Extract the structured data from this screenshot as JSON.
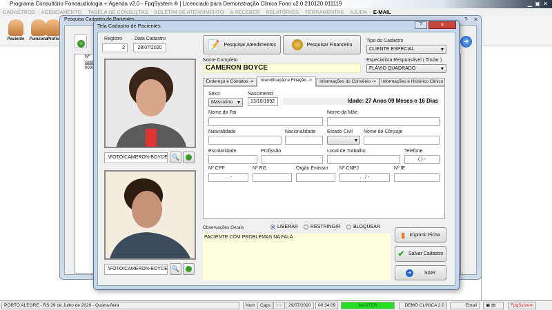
{
  "app_title": "Programa Consultório Fonoaudiologia + Agenda v2.0 - FpqSystem ® | Licenciado para  Demonstração Clinica Fono v2.0 210120 011119",
  "menu": [
    "CADASTROS",
    "AGENDAMENTO",
    "TABELA DE CONSULTAS",
    "BOLETIM DE ATENDIMENTO",
    "A RECEBER",
    "RELATÓRIOS",
    "FERRAMENTAS",
    "AJUDA",
    "E-MAIL"
  ],
  "toolbar": [
    "Paciente",
    "Funciona",
    "Profis"
  ],
  "search_window": {
    "title": "Pesquisa Cadastro de Pacientes",
    "column": "Nº",
    "rows": [
      "00002",
      "00001"
    ]
  },
  "dialog": {
    "title": "Tela Cadastro de Pacientes",
    "registro_label": "Registro",
    "registro": "2",
    "data_cadastro_label": "Data Cadastro",
    "data_cadastro": "28/07/2020",
    "photo1_path": ".\\FOTO\\CAMERON-BOYCE.JF",
    "photo2_path": ".\\FOTO\\CAMERON-BOYCE2.J",
    "btn_atendimentos": "Pesquisar  Atendimentos",
    "btn_financeiro": "Pesquisar  Financeiro",
    "tipo_label": "Tipo do Cadastro",
    "tipo": "CLIENTE ESPECIAL",
    "especialista_label": "Especialista Responsável ( Titular )",
    "especialista": "FLÁVIO QUADRADO",
    "nome_label": "Nome Completo",
    "nome": "CAMERON BOYCE",
    "tabs": [
      "Endereço e Contatos ->",
      "Identificação e Filiação ->",
      "Informações do Convênio ->",
      "Informações e Histórico Clinico"
    ],
    "panel": {
      "sexo_label": "Sexo",
      "sexo": "Masculino",
      "nascimento_label": "Nascimento",
      "nascimento": "13/10/1992",
      "idade": "Idade: 27 Anos 09 Meses e 16 Dias",
      "pai": "Nome do Pai",
      "mae": "Nome da Mãe",
      "naturalidade": "Naturalidade",
      "nacionalidade": "Nacionalidade",
      "estado_civil": "Estado Civil",
      "conjuge": "Nome do Cônjuge",
      "escolaridade": "Escolaridade",
      "profissao": "Profissão",
      "local_trabalho": "Local de Trabalho",
      "telefone": "Telefone",
      "telefone_mask": "(  )    -",
      "cpf": "Nº CPF",
      "cpf_mask": ".   .   -",
      "rg": "Nº RG",
      "orgao": "Orgão Emissor",
      "cnpj": "Nº CNPJ",
      "cnpj_mask": ".   .   /   -",
      "ie": "Nº IE"
    },
    "obs_label": "Observações Gerais",
    "radios": [
      "LIBERAR",
      "RESTRINGIR",
      "BLOQUEAR"
    ],
    "obs": "PACIENTE COM PROBLEMAS NA FALA",
    "btn_imprimir": "Imprimir Ficha",
    "btn_salvar": "Salvar Cadastro",
    "btn_sair": "SAIR"
  },
  "status": {
    "location": "PORTO ALEGRE - RS 29 de Julho de 2020 - Quarta-feira",
    "num": "Num",
    "caps": "Caps",
    "ins": "Ins",
    "date": "29/07/2020",
    "time": "00:34:09",
    "user": "MASTER",
    "clinic": "DEMO CLINICA 2.0",
    "email": "Email",
    "brand": "FpqSystem"
  }
}
